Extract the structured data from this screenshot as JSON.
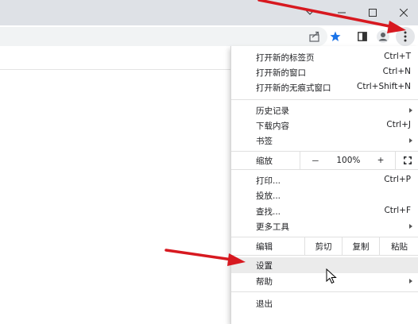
{
  "window": {
    "controls": [
      "chevron-down",
      "minimize",
      "maximize",
      "close"
    ]
  },
  "toolbar": {
    "icons": [
      "share-icon",
      "bookmark-star-icon",
      "sidebar-icon",
      "profile-icon",
      "kebab-menu-icon"
    ],
    "accent": "#1a73e8"
  },
  "menu": {
    "new_tab": {
      "label": "打开新的标签页",
      "shortcut": "Ctrl+T"
    },
    "new_window": {
      "label": "打开新的窗口",
      "shortcut": "Ctrl+N"
    },
    "new_incognito": {
      "label": "打开新的无痕式窗口",
      "shortcut": "Ctrl+Shift+N"
    },
    "history": {
      "label": "历史记录"
    },
    "downloads": {
      "label": "下载内容",
      "shortcut": "Ctrl+J"
    },
    "bookmarks": {
      "label": "书签"
    },
    "zoom": {
      "label": "缩放",
      "minus": "－",
      "value": "100%",
      "plus": "+"
    },
    "print": {
      "label": "打印...",
      "shortcut": "Ctrl+P"
    },
    "cast": {
      "label": "投放..."
    },
    "find": {
      "label": "查找...",
      "shortcut": "Ctrl+F"
    },
    "more_tools": {
      "label": "更多工具"
    },
    "edit": {
      "label": "编辑",
      "cut": "剪切",
      "copy": "复制",
      "paste": "粘贴"
    },
    "settings": {
      "label": "设置"
    },
    "help": {
      "label": "帮助"
    },
    "exit": {
      "label": "退出"
    }
  },
  "colors": {
    "annotation_arrow": "#d71920",
    "highlight": "#ebebeb"
  }
}
